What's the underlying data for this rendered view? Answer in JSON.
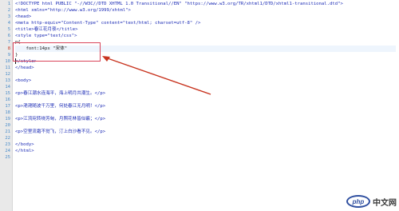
{
  "editor": {
    "line_numbers": [
      "1",
      "2",
      "3",
      "4",
      "5",
      "6",
      "7",
      "8",
      "9",
      "10",
      "11",
      "12",
      "13",
      "14",
      "15",
      "16",
      "17",
      "18",
      "19",
      "20",
      "21",
      "22",
      "23",
      "24",
      "25"
    ],
    "current_line": 8,
    "lines": [
      "<!DOCTYPE html PUBLIC \"-//W3C//DTD XHTML 1.0 Transitional//EN\" \"https://www.w3.org/TR/xhtml1/DTD/xhtml1-transitional.dtd\">",
      "<html xmlns=\"http://www.w3.org/1999/xhtml\">",
      "<head>",
      "<meta http-equiv=\"Content-Type\" content=\"text/html; charset=utf-8\" />",
      "<title>春江花月夜</title>",
      "<style type=\"text/css\">",
      "p{",
      "    font:14px \"宋体\"",
      "}",
      "</style>",
      "</head>",
      "",
      "<body>",
      "",
      "<p>春江潮水连海平，海上明月共潮生。</p>",
      "",
      "<p>滟滟随波千万里，何处春江无月明！</p>",
      "",
      "<p>江流宛转绕芳甸，月照花林皆似霰；</p>",
      "",
      "<p>空里流霜不觉飞，汀上白沙看不见。</p>",
      "",
      "</body>",
      "</html>",
      ""
    ]
  },
  "watermark": {
    "logo_text": "php",
    "site_text": "中文网"
  },
  "colors": {
    "highlight_box": "#d9455a",
    "arrow": "#c8341f",
    "line_number": "#4a8cc9",
    "tag": "#1b2bb5"
  }
}
